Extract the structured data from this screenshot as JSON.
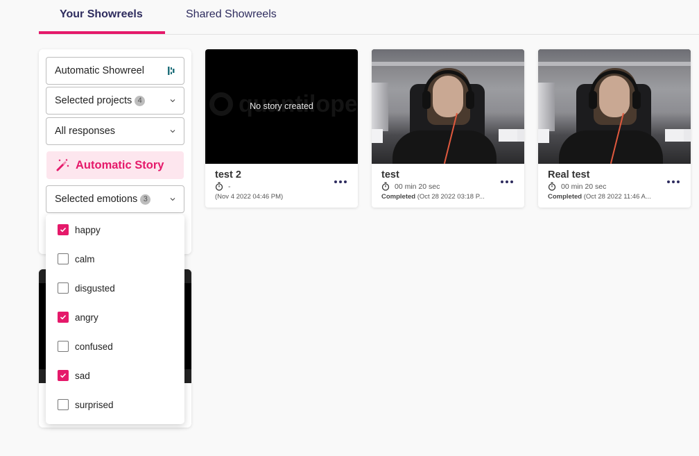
{
  "tabs": [
    {
      "label": "Your Showreels",
      "active": true
    },
    {
      "label": "Shared Showreels",
      "active": false
    }
  ],
  "accent_color": "#e5196a",
  "nav_color": "#2e2c5e",
  "panel": {
    "name_field": {
      "value": "Automatic Showreel",
      "icon": "brand-logo-icon"
    },
    "projects_select": {
      "label": "Selected projects",
      "badge": "4"
    },
    "responses_select": {
      "label": "All responses"
    },
    "story_button": {
      "label": "Automatic Story",
      "icon": "magic-wand-icon"
    },
    "emotions_select": {
      "label": "Selected emotions",
      "badge": "3"
    }
  },
  "emotions": [
    {
      "label": "happy",
      "checked": true
    },
    {
      "label": "calm",
      "checked": false
    },
    {
      "label": "disgusted",
      "checked": false
    },
    {
      "label": "angry",
      "checked": true
    },
    {
      "label": "confused",
      "checked": false
    },
    {
      "label": "sad",
      "checked": true
    },
    {
      "label": "surprised",
      "checked": false
    }
  ],
  "showreels": [
    {
      "title": "test 2",
      "duration": "-",
      "status": "",
      "date": "(Nov 4 2022 04:46 PM)",
      "thumbnail": "empty",
      "placeholder": "No story created",
      "watermark": "quantilope"
    },
    {
      "title": "test",
      "duration": "00 min 20 sec",
      "status": "Completed",
      "date": "(Oct 28 2022 03:18 P...",
      "thumbnail": "video-frame"
    },
    {
      "title": "Real test",
      "duration": "00 min 20 sec",
      "status": "Completed",
      "date": "(Oct 28 2022 11:46 A...",
      "thumbnail": "video-frame"
    }
  ]
}
